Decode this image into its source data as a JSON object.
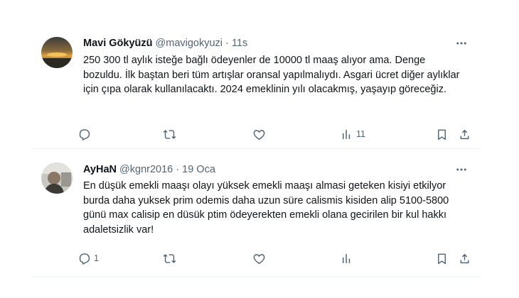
{
  "tweets": [
    {
      "name": "Mavi Gökyüzü",
      "handle": "@mavigokyuzi",
      "separator": "·",
      "time": "11s",
      "text": "250 300 tl aylık isteğe bağlı ödeyenler de 10000 tl maaş alıyor ama. Denge bozuldu. İlk baştan beri tüm artışlar oransal yapılmalıydı. Asgari ücret diğer aylıklar için çıpa olarak kullanılacaktı. 2024 emeklinin yılı olacakmış, yaşayıp göreceğiz.",
      "replies": "",
      "retweets": "",
      "likes": "",
      "views": "11"
    },
    {
      "name": "AyHaN",
      "handle": "@kgnr2016",
      "separator": "·",
      "time": "19 Oca",
      "text": "En düşük emekli maaşı olayı yüksek emekli maaşı almasi geteken kisiyi etkilyor burda daha yuksek prim odemis daha uzun süre calismis kisiden alip 5100-5800 günü max calisip en düsük ptim ödeyerekten emekli olana gecirilen bir kul hakkı adaletsizlik var!",
      "replies": "1",
      "retweets": "",
      "likes": "",
      "views": ""
    }
  ],
  "icons": {
    "reply": "reply-icon",
    "retweet": "retweet-icon",
    "like": "heart-icon",
    "views": "views-icon",
    "bookmark": "bookmark-icon",
    "share": "share-icon",
    "more": "more-icon"
  },
  "colors": {
    "text": "#0f1419",
    "secondary": "#536471",
    "divider": "#eff3f4"
  }
}
